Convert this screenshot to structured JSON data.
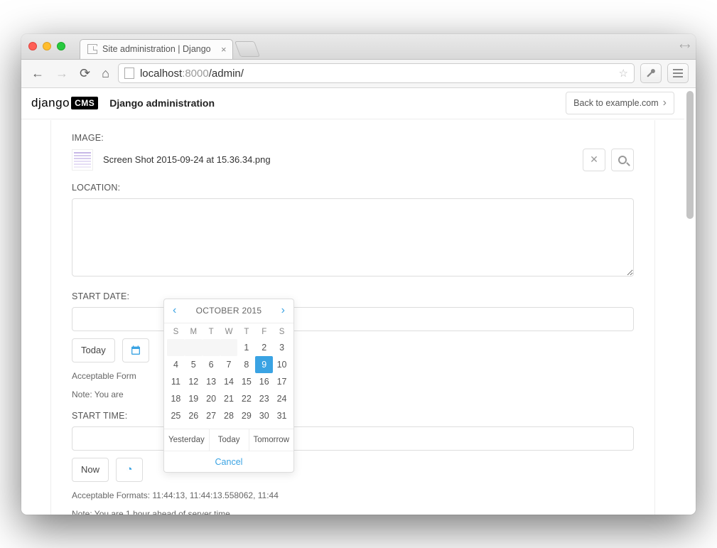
{
  "browser": {
    "tab_title": "Site administration | Django",
    "url_host": "localhost",
    "url_port": ":8000",
    "url_path": "/admin/"
  },
  "header": {
    "brand_prefix": "django",
    "brand_badge": "CMS",
    "admin_title": "Django administration",
    "back_label": "Back to example.com"
  },
  "form": {
    "image_label": "IMAGE:",
    "image_filename": "Screen Shot 2015-09-24 at 15.36.34.png",
    "location_label": "LOCATION:",
    "location_value": "",
    "start_date_label": "START DATE:",
    "start_date_value": "",
    "today_btn": "Today",
    "date_formats_hint": "Acceptable Form",
    "date_tz_note": "Note: You are",
    "start_time_label": "START TIME:",
    "start_time_value": "",
    "now_btn": "Now",
    "time_formats_hint": "Acceptable Formats: 11:44:13, 11:44:13.558062, 11:44",
    "time_tz_note": "Note: You are 1 hour ahead of server time."
  },
  "datepicker": {
    "month_label": "OCTOBER 2015",
    "dow": [
      "S",
      "M",
      "T",
      "W",
      "T",
      "F",
      "S"
    ],
    "pad_before": 4,
    "days_in_month": 31,
    "selected_day": 9,
    "quick_yesterday": "Yesterday",
    "quick_today": "Today",
    "quick_tomorrow": "Tomorrow",
    "cancel": "Cancel"
  }
}
